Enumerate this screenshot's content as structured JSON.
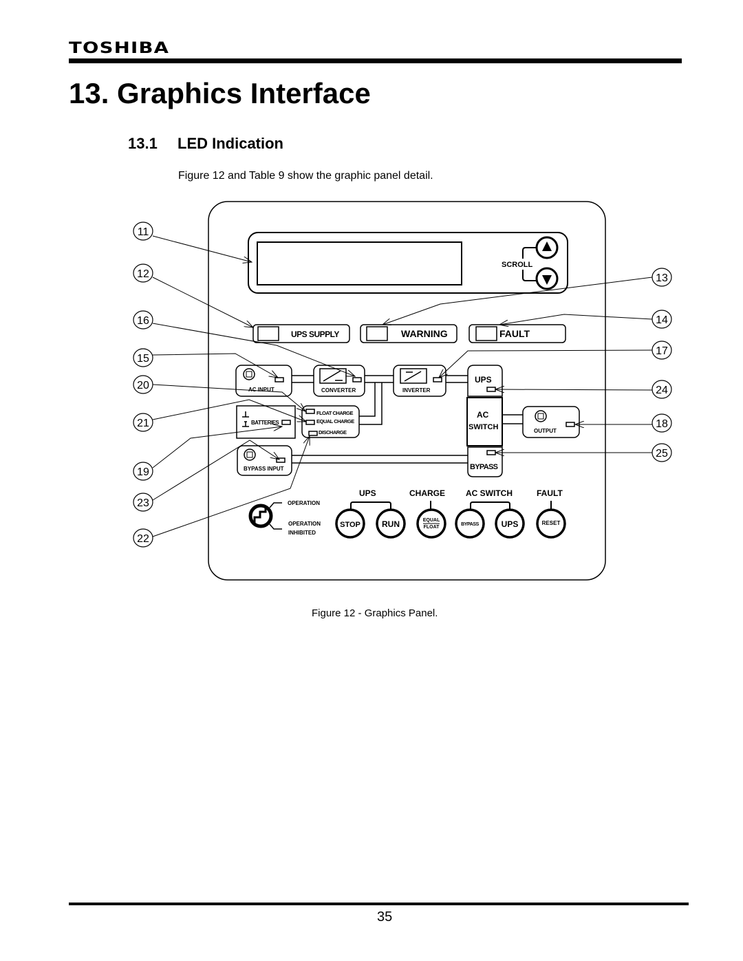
{
  "header": {
    "brand": "TOSHIBA",
    "title": "13. Graphics Interface",
    "section_number": "13.1",
    "section_title": "LED Indication"
  },
  "intro": "Figure 12 and Table 9 show the graphic panel detail.",
  "panel": {
    "scroll_label": "SCROLL",
    "indicators": {
      "ups_supply": "UPS SUPPLY",
      "warning": "WARNING",
      "fault": "FAULT"
    },
    "blocks": {
      "ac_input": "AC INPUT",
      "converter": "CONVERTER",
      "inverter": "INVERTER",
      "ups": "UPS",
      "batteries": "BATTERIES",
      "float_charge": "FLOAT CHARGE",
      "equal_charge": "EQUAL CHARGE",
      "discharge": "DISCHARGE",
      "ac_switch_line1": "AC",
      "ac_switch_line2": "SWITCH",
      "output": "OUTPUT",
      "bypass_input": "BYPASS INPUT",
      "bypass": "BYPASS"
    },
    "operation": {
      "operation": "OPERATION",
      "inhibited_line1": "OPERATION",
      "inhibited_line2": "INHIBITED"
    },
    "button_groups": {
      "ups": "UPS",
      "charge": "CHARGE",
      "ac_switch": "AC SWITCH",
      "fault": "FAULT"
    },
    "buttons": {
      "stop": "STOP",
      "run": "RUN",
      "equal": "EQUAL",
      "float": "FLOAT",
      "bypass": "BYPASS",
      "ups": "UPS",
      "reset": "RESET"
    }
  },
  "callouts": [
    "11",
    "12",
    "16",
    "15",
    "20",
    "21",
    "19",
    "23",
    "22",
    "13",
    "14",
    "17",
    "24",
    "18",
    "25"
  ],
  "caption": "Figure 12 - Graphics Panel.",
  "footer": {
    "page_number": "35"
  }
}
